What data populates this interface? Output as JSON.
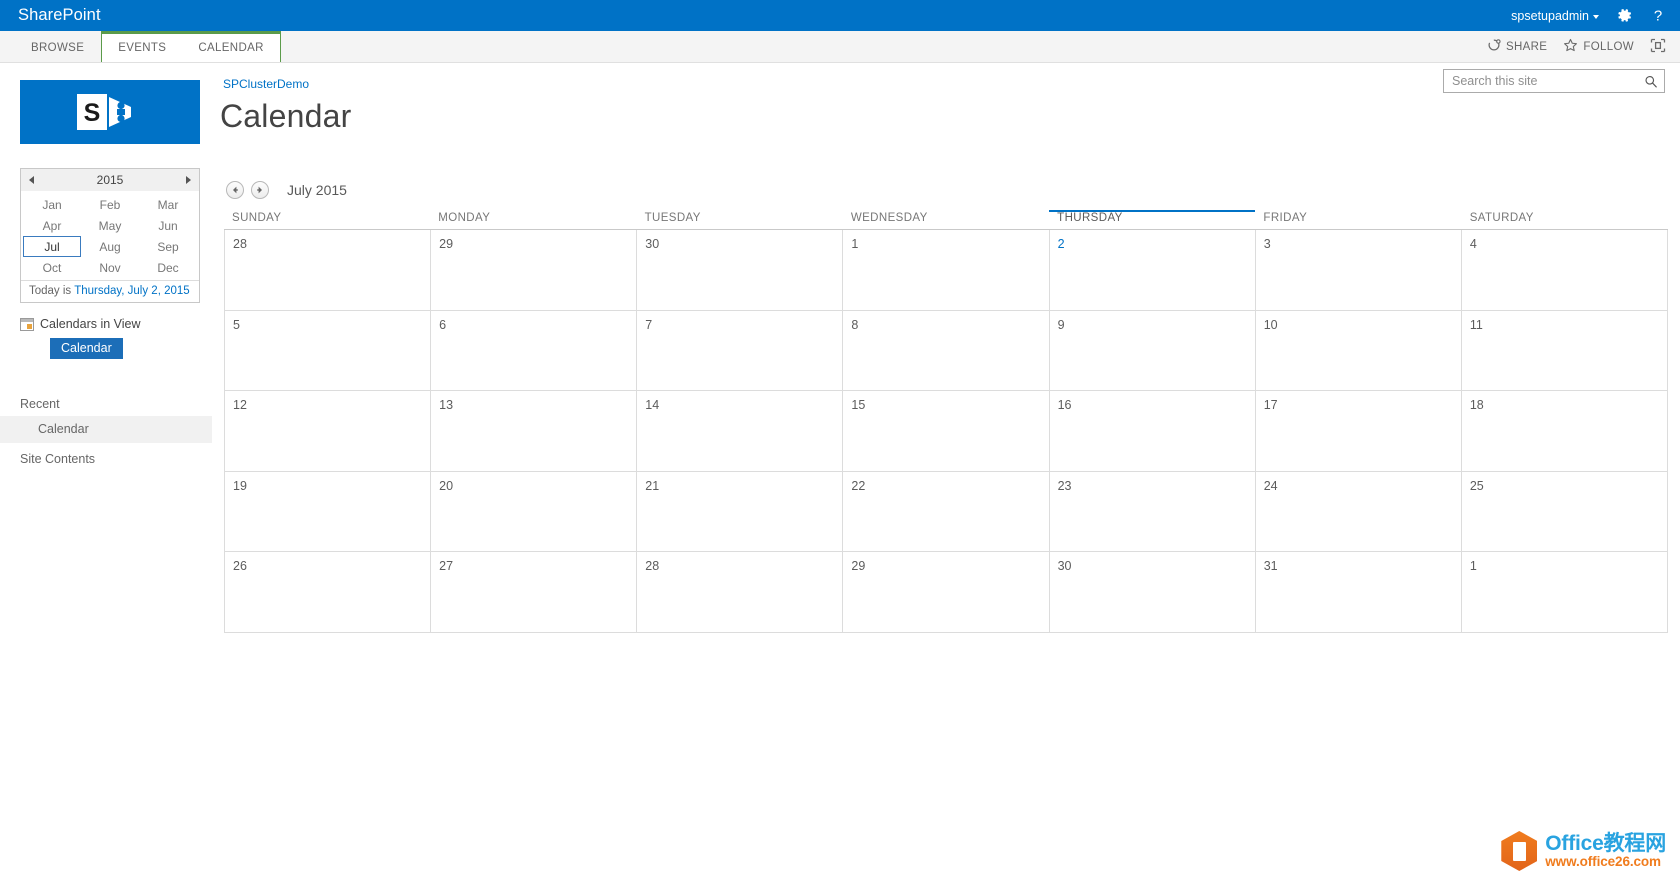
{
  "suite": {
    "brand": "SharePoint",
    "user": "spsetupadmin",
    "settings_icon": "gear-icon",
    "help_icon": "help-icon"
  },
  "ribbon": {
    "tabs": [
      {
        "label": "BROWSE",
        "selected": false
      },
      {
        "label": "EVENTS",
        "selected": true
      },
      {
        "label": "CALENDAR",
        "selected": true
      }
    ],
    "actions": [
      {
        "label": "SHARE",
        "icon": "share-icon"
      },
      {
        "label": "FOLLOW",
        "icon": "star-icon"
      },
      {
        "label": "",
        "icon": "focus-on-content-icon"
      }
    ]
  },
  "site": {
    "logo_icon": "sharepoint-logo-icon",
    "breadcrumb": "SPClusterDemo",
    "page_title": "Calendar"
  },
  "search": {
    "placeholder": "Search this site",
    "value": "",
    "icon": "search-icon"
  },
  "datepicker": {
    "year": "2015",
    "prev_icon": "triangle-left-icon",
    "next_icon": "triangle-right-icon",
    "months": [
      "Jan",
      "Feb",
      "Mar",
      "Apr",
      "May",
      "Jun",
      "Jul",
      "Aug",
      "Sep",
      "Oct",
      "Nov",
      "Dec"
    ],
    "selected_month": "Jul",
    "today_prefix": "Today is ",
    "today_link": "Thursday, July 2, 2015"
  },
  "calendars_in_view": {
    "icon": "calendar-small-icon",
    "label": "Calendars in View",
    "chips": [
      "Calendar"
    ]
  },
  "quicklaunch": {
    "recent_label": "Recent",
    "items": [
      {
        "label": "Calendar",
        "active": true
      }
    ],
    "site_contents_label": "Site Contents"
  },
  "calendar": {
    "prev_icon": "arrow-left-circle-icon",
    "next_icon": "arrow-right-circle-icon",
    "month_label": "July 2015",
    "day_headers": [
      "SUNDAY",
      "MONDAY",
      "TUESDAY",
      "WEDNESDAY",
      "THURSDAY",
      "FRIDAY",
      "SATURDAY"
    ],
    "today_column_index": 4,
    "today_day": "2",
    "weeks": [
      [
        "28",
        "29",
        "30",
        "1",
        "2",
        "3",
        "4"
      ],
      [
        "5",
        "6",
        "7",
        "8",
        "9",
        "10",
        "11"
      ],
      [
        "12",
        "13",
        "14",
        "15",
        "16",
        "17",
        "18"
      ],
      [
        "19",
        "20",
        "21",
        "22",
        "23",
        "24",
        "25"
      ],
      [
        "26",
        "27",
        "28",
        "29",
        "30",
        "31",
        "1"
      ]
    ]
  },
  "watermark": {
    "line1": "Office教程网",
    "line2": "www.office26.com",
    "logo_icon": "office-hex-logo-icon"
  },
  "colors": {
    "suite_blue": "#0072C6",
    "tab_green": "#5B9B4A",
    "chip_blue": "#1C6EB8",
    "accent_link": "#0072C6"
  }
}
